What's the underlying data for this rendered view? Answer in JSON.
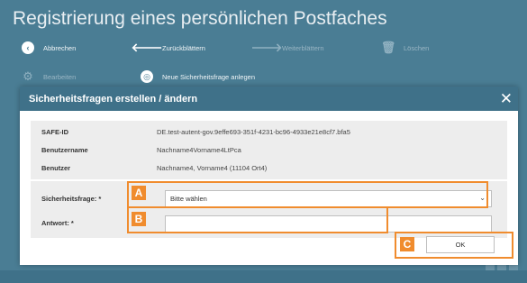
{
  "app": {
    "title": "Registrierung eines persönlichen Postfaches",
    "toolbar_row1": [
      {
        "label": "Abbrechen",
        "icon": "back-circle-icon",
        "enabled": true
      },
      {
        "label": "Zurückblättern",
        "icon": "arrow-left-icon",
        "enabled": true
      },
      {
        "label": "Weiterblättern",
        "icon": "arrow-right-icon",
        "enabled": false
      },
      {
        "label": "Löschen",
        "icon": "trash-icon",
        "enabled": false
      }
    ],
    "toolbar_row2": [
      {
        "label": "Bearbeiten",
        "icon": "gear-icon",
        "enabled": false
      },
      {
        "label": "Neue Sicherheitsfrage anlegen",
        "icon": "lifebuoy-icon",
        "enabled": true
      }
    ]
  },
  "modal": {
    "title": "Sicherheitsfragen erstellen / ändern",
    "close_glyph": "✕",
    "info": [
      {
        "label": "SAFE-ID",
        "value": "DE.test-autent-gov.9effe693-351f-4231-bc96-4933e21e8cf7.bfa5"
      },
      {
        "label": "Benutzername",
        "value": "Nachname4Vorname4LtPca"
      },
      {
        "label": "Benutzer",
        "value": "Nachname4, Vorname4 (11104 Ort4)"
      }
    ],
    "form": {
      "question_label": "Sicherheitsfrage: *",
      "question_selected": "Bitte wählen",
      "answer_label": "Antwort: *",
      "answer_value": ""
    },
    "ok_label": "OK"
  },
  "annotations": [
    {
      "letter": "A"
    },
    {
      "letter": "B"
    },
    {
      "letter": "C"
    }
  ],
  "colors": {
    "header": "#3f7189",
    "background": "#4a7d94",
    "annotation": "#f08c2e"
  }
}
